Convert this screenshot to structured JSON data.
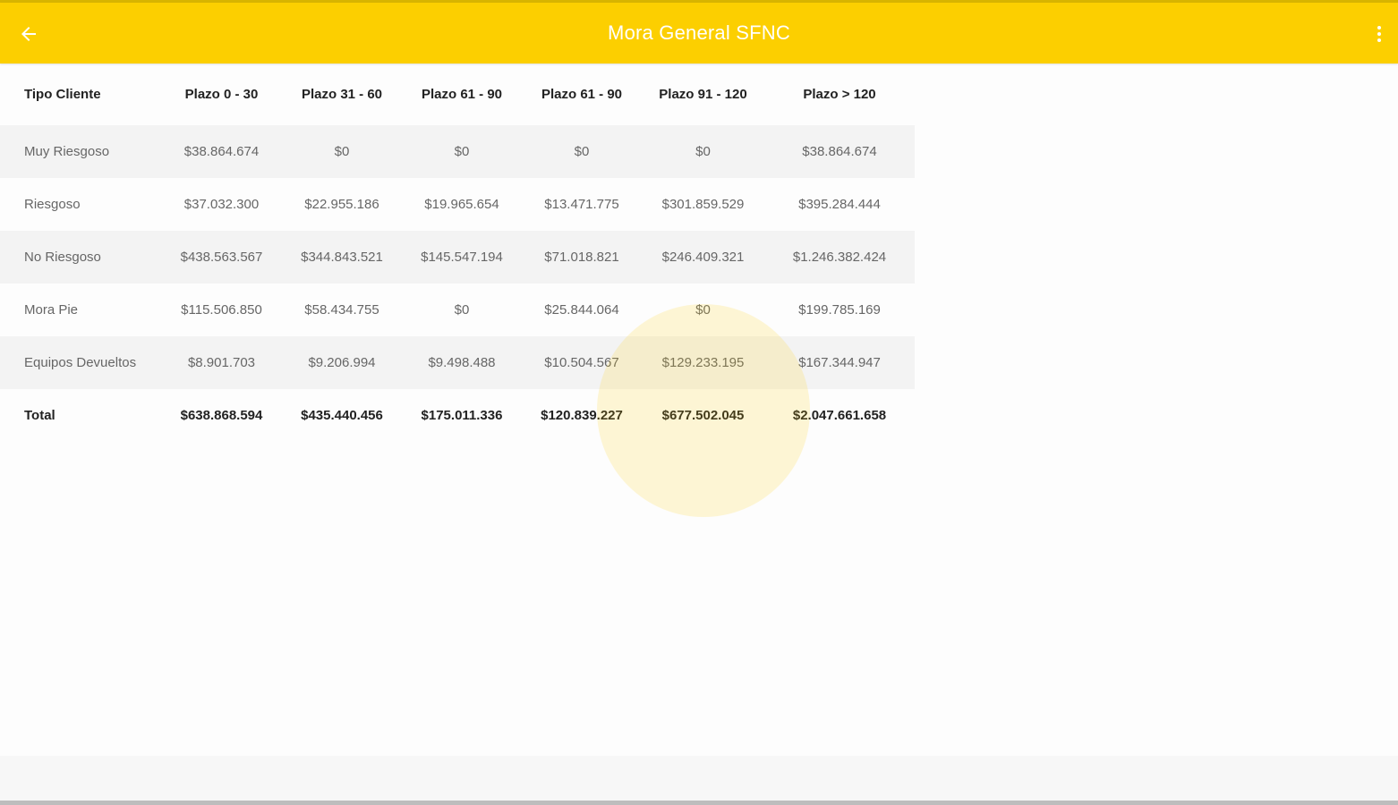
{
  "appbar": {
    "title": "Mora General SFNC",
    "back_icon": "arrow-left-icon",
    "menu_icon": "more-vertical-icon",
    "color": "#fccf00"
  },
  "table": {
    "headers": [
      "Tipo Cliente",
      "Plazo 0 - 30",
      "Plazo 31 - 60",
      "Plazo 61 - 90",
      "Plazo 61 - 90",
      "Plazo 91 - 120",
      "Plazo > 120"
    ],
    "rows": [
      {
        "label": "Muy Riesgoso",
        "values": [
          "$38.864.674",
          "$0",
          "$0",
          "$0",
          "$0",
          "$38.864.674"
        ]
      },
      {
        "label": "Riesgoso",
        "values": [
          "$37.032.300",
          "$22.955.186",
          "$19.965.654",
          "$13.471.775",
          "$301.859.529",
          "$395.284.444"
        ]
      },
      {
        "label": "No Riesgoso",
        "values": [
          "$438.563.567",
          "$344.843.521",
          "$145.547.194",
          "$71.018.821",
          "$246.409.321",
          "$1.246.382.424"
        ]
      },
      {
        "label": "Mora Pie",
        "values": [
          "$115.506.850",
          "$58.434.755",
          "$0",
          "$25.844.064",
          "$0",
          "$199.785.169"
        ]
      },
      {
        "label": "Equipos Devueltos",
        "values": [
          "$8.901.703",
          "$9.206.994",
          "$9.498.488",
          "$10.504.567",
          "$129.233.195",
          "$167.344.947"
        ]
      }
    ],
    "total": {
      "label": "Total",
      "values": [
        "$638.868.594",
        "$435.440.456",
        "$175.011.336",
        "$120.839.227",
        "$677.502.045",
        "$2.047.661.658"
      ]
    }
  }
}
